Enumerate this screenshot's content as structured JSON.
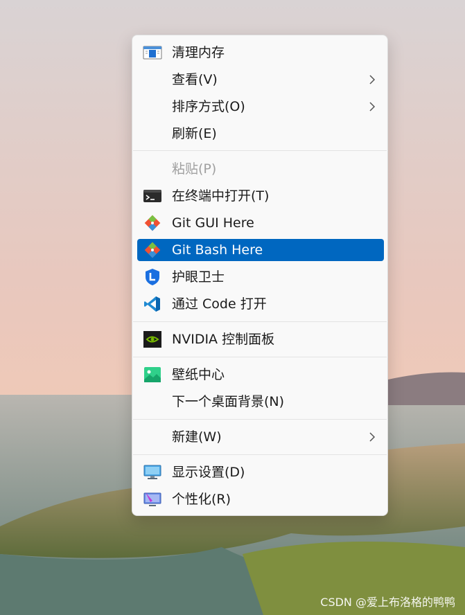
{
  "menu": {
    "items": [
      {
        "label": "清理内存",
        "icon": "memory-clean-icon"
      },
      {
        "label": "查看(V)",
        "submenu": true
      },
      {
        "label": "排序方式(O)",
        "submenu": true
      },
      {
        "label": "刷新(E)"
      },
      {
        "label": "粘贴(P)",
        "disabled": true
      },
      {
        "label": "在终端中打开(T)",
        "icon": "terminal-icon"
      },
      {
        "label": "Git GUI Here",
        "icon": "git-icon"
      },
      {
        "label": "Git Bash Here",
        "icon": "git-icon",
        "highlighted": true
      },
      {
        "label": "护眼卫士",
        "icon": "eye-guard-shield-icon"
      },
      {
        "label": "通过 Code 打开",
        "icon": "vscode-icon"
      },
      {
        "label": "NVIDIA 控制面板",
        "icon": "nvidia-icon"
      },
      {
        "label": "壁纸中心",
        "icon": "wallpaper-icon"
      },
      {
        "label": "下一个桌面背景(N)"
      },
      {
        "label": "新建(W)",
        "submenu": true
      },
      {
        "label": "显示设置(D)",
        "icon": "display-icon"
      },
      {
        "label": "个性化(R)",
        "icon": "personalize-icon"
      }
    ]
  },
  "colors": {
    "highlight": "#0067c0",
    "menu_bg": "#f9f9f9",
    "disabled_text": "#a0a0a0"
  },
  "watermark": "CSDN @爱上布洛格的鸭鸭"
}
